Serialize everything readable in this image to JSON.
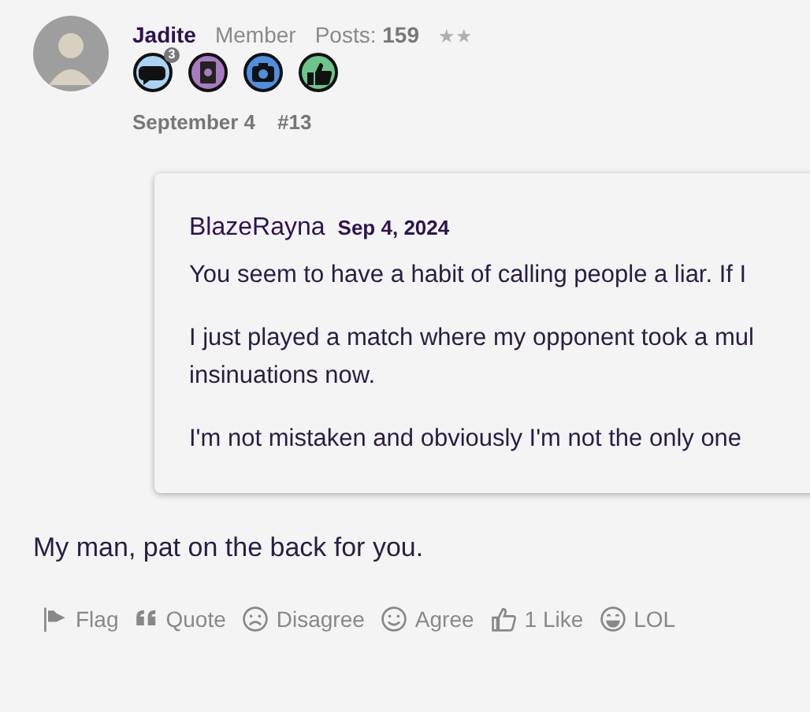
{
  "post": {
    "author": "Jadite",
    "role": "Member",
    "posts": "Posts: **159**",
    "stars": "★★",
    "badges": [
      {
        "kind": "chat",
        "color": "#a8d4f5",
        "count": "3"
      },
      {
        "kind": "book",
        "color": "#a77bbf"
      },
      {
        "kind": "camera",
        "color": "#4f8fe0"
      },
      {
        "kind": "thumb",
        "color": "#6cc68a"
      }
    ],
    "date": "September 4",
    "number": "#13",
    "quote": {
      "author": "BlazeRayna",
      "date": "Sep 4, 2024",
      "paragraphs": [
        "You seem to have a habit of calling people a liar. If I",
        "I just played a match where my opponent took a mul\ninsinuations now.",
        "I'm not mistaken and obviously I'm not the only one"
      ]
    },
    "body": "My man, pat on the back for you.",
    "actions": [
      {
        "kind": "flag",
        "label": "Flag"
      },
      {
        "kind": "quote",
        "label": "Quote"
      },
      {
        "kind": "sad",
        "label": "Disagree"
      },
      {
        "kind": "smile",
        "label": "Agree"
      },
      {
        "kind": "like",
        "label": "1 Like"
      },
      {
        "kind": "laugh",
        "label": "LOL"
      }
    ]
  }
}
